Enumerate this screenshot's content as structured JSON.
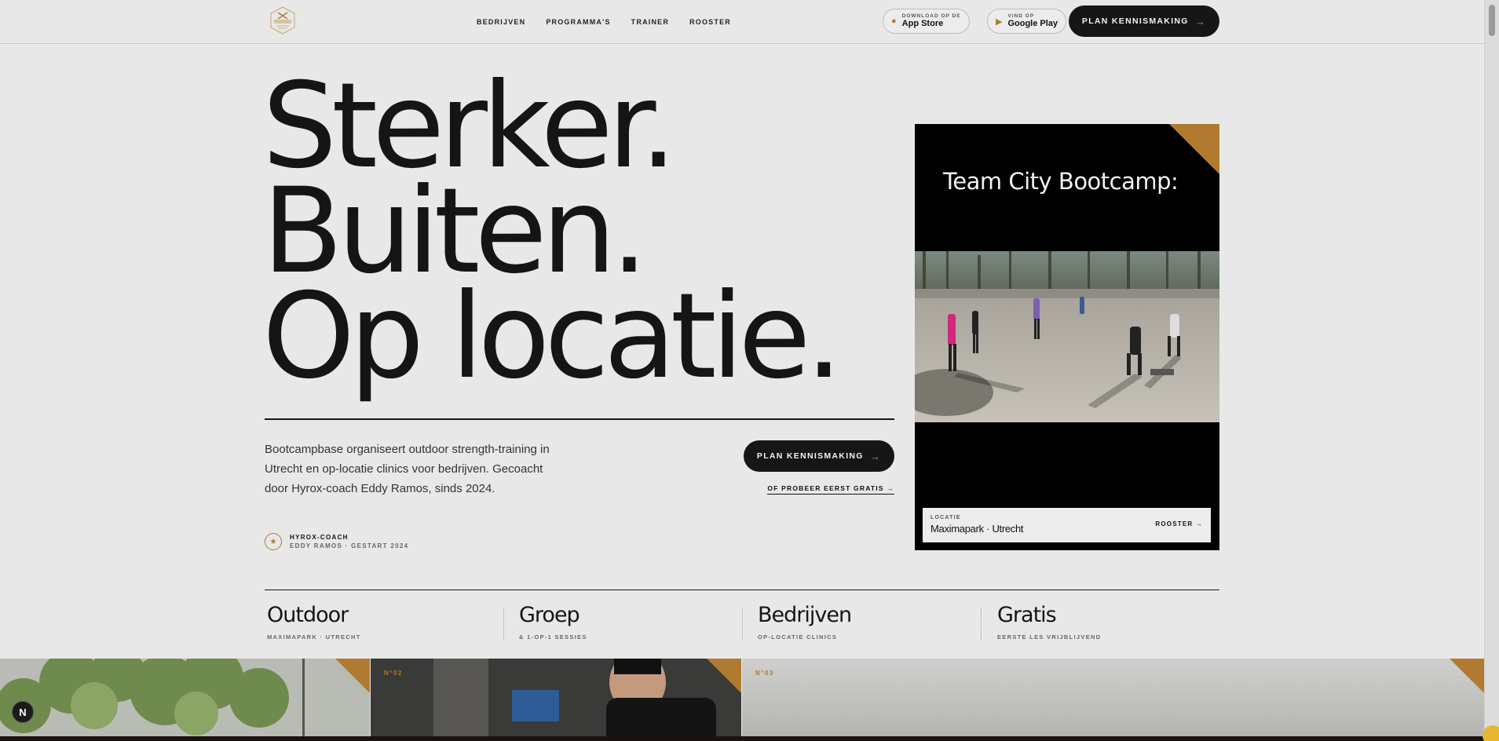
{
  "header": {
    "nav": [
      "BEDRIJVEN",
      "PROGRAMMA'S",
      "TRAINER",
      "ROOSTER"
    ],
    "app_store": {
      "small": "DOWNLOAD OP DE",
      "big": "App Store"
    },
    "google_play": {
      "small": "VIND OP",
      "big": "Google Play"
    },
    "cta": "PLAN KENNISMAKING"
  },
  "hero": {
    "lines": [
      "Sterker.",
      "Buiten.",
      "Op locatie."
    ],
    "intro": "Bootcampbase organiseert outdoor strength-training in Utrecht en op-locatie clinics voor bedrijven. Gecoacht door Hyrox-coach Eddy Ramos, sinds 2024.",
    "badge_title": "HYROX-COACH",
    "badge_sub": "EDDY RAMOS · GESTART 2024",
    "cta": "PLAN KENNISMAKING",
    "try_link": "OF PROBEER EERST GRATIS"
  },
  "card": {
    "title": "Team City Bootcamp:",
    "location_label": "LOCATIE",
    "location_value": "Maximapark · Utrecht",
    "link": "ROOSTER"
  },
  "features": [
    {
      "title": "Outdoor",
      "sub": "MAXIMAPARK · UTRECHT"
    },
    {
      "title": "Groep",
      "sub": "& 1-OP-1 SESSIES"
    },
    {
      "title": "Bedrijven",
      "sub": "OP-LOCATIE CLINICS"
    },
    {
      "title": "Gratis",
      "sub": "EERSTE LES VRIJBLIJVEND"
    }
  ],
  "tiles": [
    {
      "num": ""
    },
    {
      "num": "N°02"
    },
    {
      "num": "N°03"
    }
  ],
  "arrow": "→",
  "dev_badge": "N",
  "colors": {
    "accent": "#b07a30",
    "dark": "#161616",
    "background": "#e8e8e8"
  }
}
